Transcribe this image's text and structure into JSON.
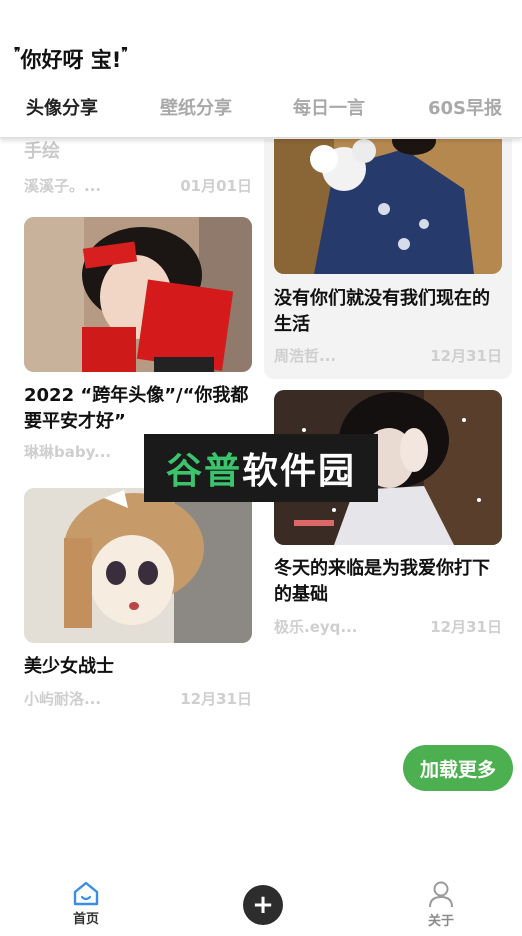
{
  "greeting": {
    "open_quote": "❞",
    "text": "你好呀 宝!",
    "close_quote": "❞"
  },
  "tabs": [
    {
      "label": "头像分享",
      "active": true
    },
    {
      "label": "壁纸分享",
      "active": false
    },
    {
      "label": "每日一言",
      "active": false
    },
    {
      "label": "60S早报",
      "active": false
    }
  ],
  "cards": [
    {
      "title": "手绘",
      "author": "溪溪子。...",
      "date": "01月01日"
    },
    {
      "title": "2022 “跨年头像”/“你我都要平安才好”",
      "author": "琳琳baby...",
      "date": ""
    },
    {
      "title": "美少女战士",
      "author": "小屿耐洛...",
      "date": "12月31日"
    },
    {
      "title": "没有你们就没有我们现在的生活",
      "author": "周浩哲...",
      "date": "12月31日"
    },
    {
      "title": "冬天的来临是为我爱你打下的基础",
      "author": "极乐.eyq...",
      "date": "12月31日"
    }
  ],
  "watermark": {
    "part1": "谷普",
    "part2": "软件园"
  },
  "load_more": "加载更多",
  "nav": {
    "home": "首页",
    "add": "+",
    "about": "关于"
  },
  "colors": {
    "accent": "#4caf50",
    "active_nav": "#3a8ee6",
    "muted": "#cfcfcf"
  }
}
